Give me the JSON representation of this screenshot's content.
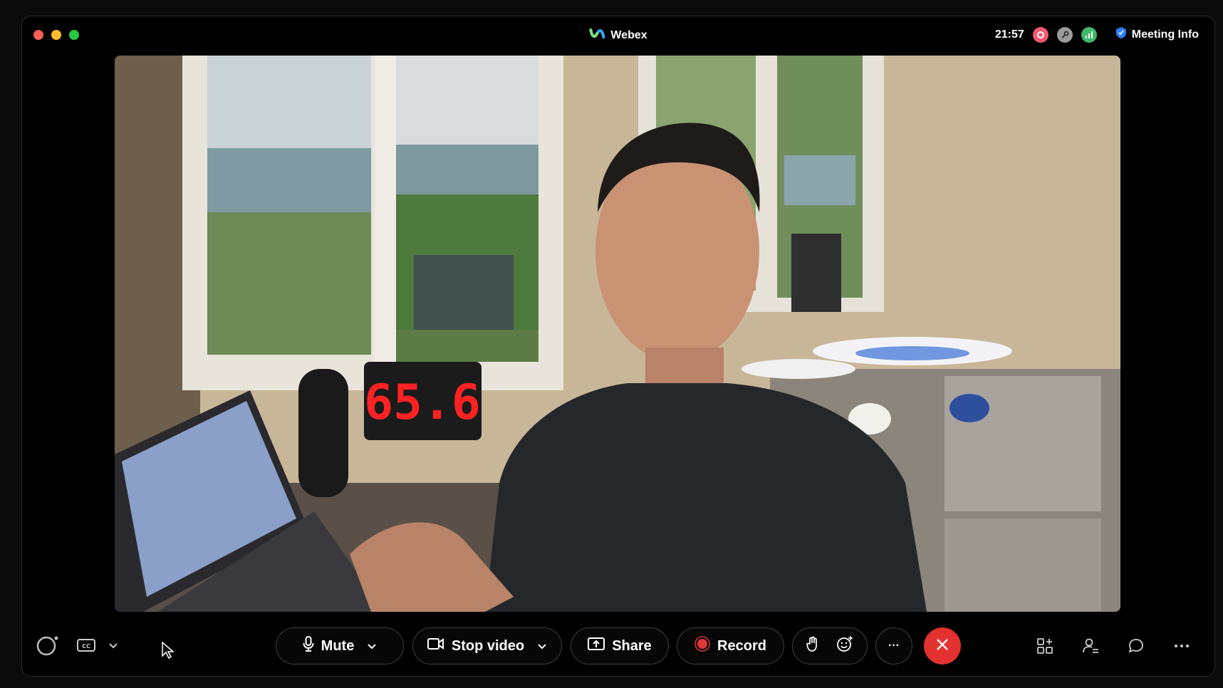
{
  "window": {
    "app_title": "Webex",
    "time": "21:57",
    "meeting_info_label": "Meeting Info"
  },
  "video": {
    "display_reading": "65.6"
  },
  "controls": {
    "mute_label": "Mute",
    "stop_video_label": "Stop video",
    "share_label": "Share",
    "record_label": "Record",
    "more_label": "···"
  },
  "colors": {
    "leave": "#e2312e",
    "record": "#e0363a",
    "accent_blue": "#2d7ff9"
  }
}
